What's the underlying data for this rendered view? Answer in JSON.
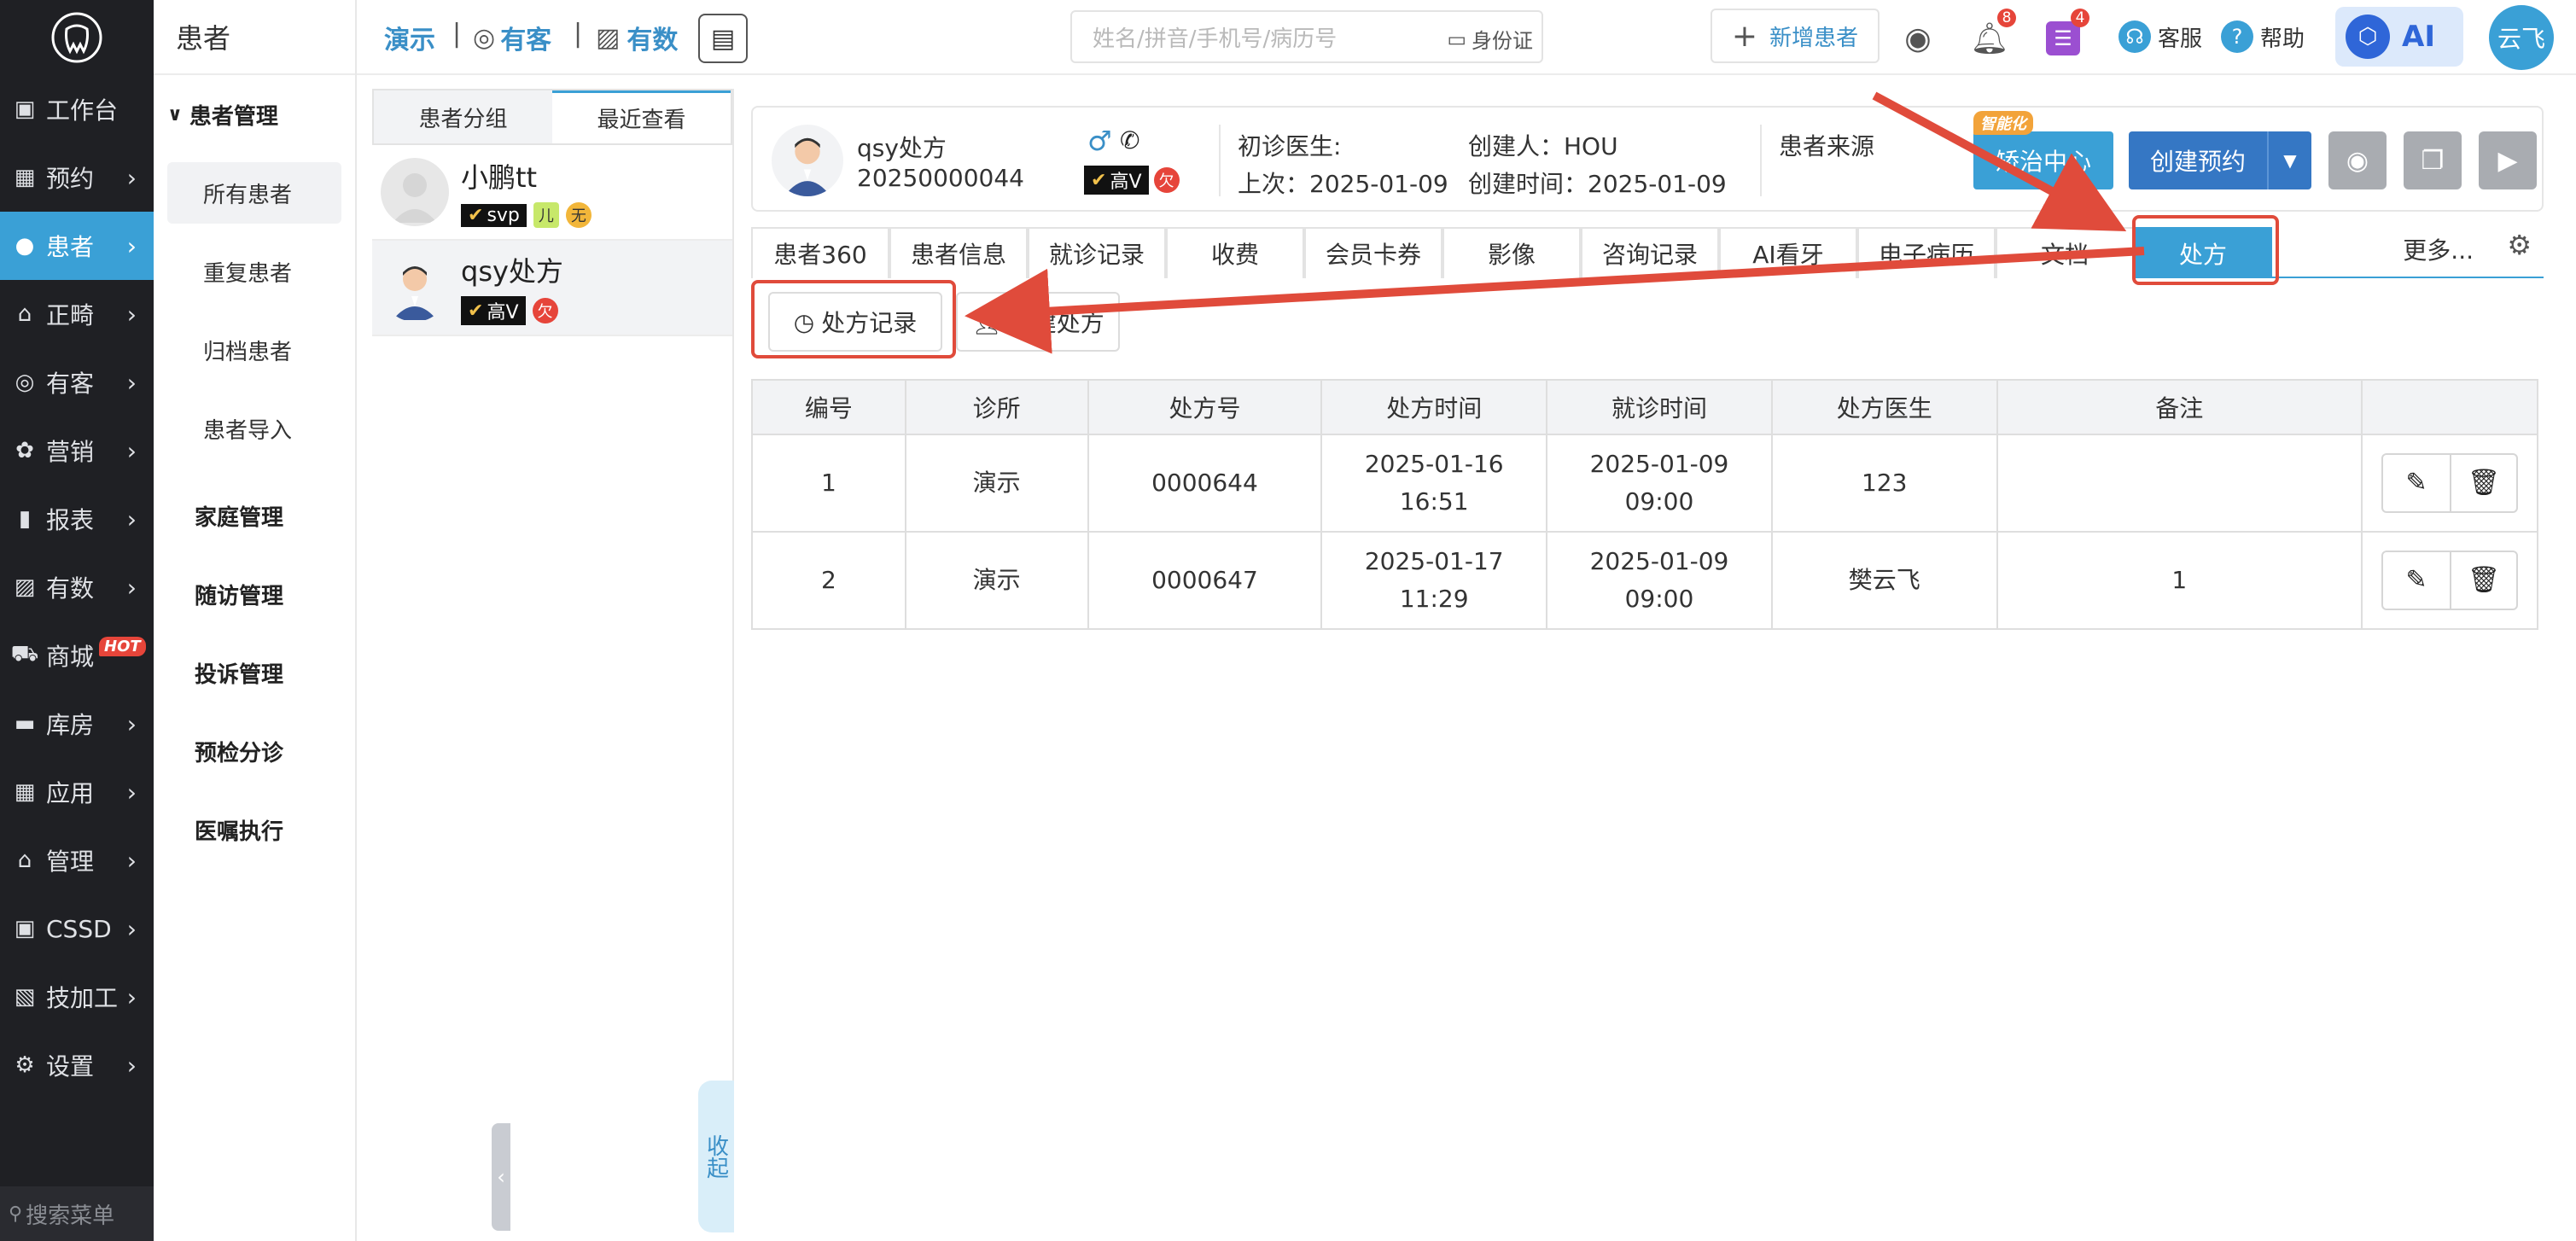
{
  "sidebar": {
    "items": [
      {
        "label": "工作台",
        "icon": "dashboard-icon",
        "active": false,
        "chev": false
      },
      {
        "label": "预约",
        "icon": "calendar-icon",
        "active": false,
        "chev": true
      },
      {
        "label": "患者",
        "icon": "patient-icon",
        "active": true,
        "chev": true
      },
      {
        "label": "正畸",
        "icon": "tooth-icon",
        "active": false,
        "chev": true
      },
      {
        "label": "有客",
        "icon": "guest-icon",
        "active": false,
        "chev": true
      },
      {
        "label": "营销",
        "icon": "marketing-icon",
        "active": false,
        "chev": true
      },
      {
        "label": "报表",
        "icon": "report-icon",
        "active": false,
        "chev": true
      },
      {
        "label": "有数",
        "icon": "data-icon",
        "active": false,
        "chev": true
      },
      {
        "label": "商城",
        "icon": "cart-icon",
        "active": false,
        "chev": false,
        "badge": "HOT"
      },
      {
        "label": "库房",
        "icon": "warehouse-icon",
        "active": false,
        "chev": true
      },
      {
        "label": "应用",
        "icon": "apps-icon",
        "active": false,
        "chev": true
      },
      {
        "label": "管理",
        "icon": "manage-icon",
        "active": false,
        "chev": true
      },
      {
        "label": "CSSD",
        "icon": "cssd-icon",
        "active": false,
        "chev": true
      },
      {
        "label": "技加工",
        "icon": "lab-icon",
        "active": false,
        "chev": true
      },
      {
        "label": "设置",
        "icon": "settings-icon",
        "active": false,
        "chev": true
      }
    ],
    "search_placeholder": "搜索菜单"
  },
  "submenu": {
    "title": "患者",
    "group": "患者管理",
    "items": [
      "所有患者",
      "重复患者",
      "归档患者",
      "患者导入"
    ],
    "sections": [
      "家庭管理",
      "随访管理",
      "投诉管理",
      "预检分诊",
      "医嘱执行"
    ]
  },
  "topbar": {
    "clinic": "演示",
    "youke": "有客",
    "youshu": "有数",
    "search_placeholder": "姓名/拼音/手机号/病历号",
    "idcard": "身份证",
    "new_patient": "新增患者",
    "bell_badge": "8",
    "task_badge": "4",
    "service": "客服",
    "help": "帮助",
    "ai": "AI",
    "user": "云飞"
  },
  "plist": {
    "tabs": [
      "患者分组",
      "最近查看"
    ],
    "patients": [
      {
        "name": "小鹏tt",
        "vip": "svp",
        "tags": [
          "儿",
          "无"
        ]
      },
      {
        "name": "qsy处方",
        "vip": "高V",
        "tags": [
          "欠"
        ]
      }
    ],
    "collapse": "收起"
  },
  "patient": {
    "name": "qsy处方",
    "id": "20250000044",
    "vip": "高V",
    "owe": "欠",
    "first_doctor": "初诊医生:",
    "last_visit": "上次：2025-01-09",
    "creator": "创建人：HOU",
    "created": "创建时间：2025-01-09",
    "source": "患者来源",
    "smart": "智能化",
    "btn_consult": "矫治中心",
    "btn_appt": "创建预约"
  },
  "tabs": [
    "患者360",
    "患者信息",
    "就诊记录",
    "收费",
    "会员卡券",
    "影像",
    "咨询记录",
    "AI看牙",
    "电子病历",
    "文档",
    "处方"
  ],
  "tabs_more": "更多...",
  "sub_buttons": {
    "record": "处方记录",
    "new": "新建处方"
  },
  "table": {
    "headers": [
      "编号",
      "诊所",
      "处方号",
      "处方时间",
      "就诊时间",
      "处方医生",
      "备注",
      ""
    ],
    "rows": [
      {
        "no": "1",
        "clinic": "演示",
        "rx": "0000644",
        "rx_date": "2025-01-16",
        "rx_time": "16:51",
        "visit_date": "2025-01-09",
        "visit_time": "09:00",
        "doctor": "123",
        "note": ""
      },
      {
        "no": "2",
        "clinic": "演示",
        "rx": "0000647",
        "rx_date": "2025-01-17",
        "rx_time": "11:29",
        "visit_date": "2025-01-09",
        "visit_time": "09:00",
        "doctor": "樊云飞",
        "note": "1"
      }
    ]
  },
  "colors": {
    "accent": "#3aa0d6",
    "sidebar": "#1f2024",
    "highlight": "#e04b3b"
  }
}
